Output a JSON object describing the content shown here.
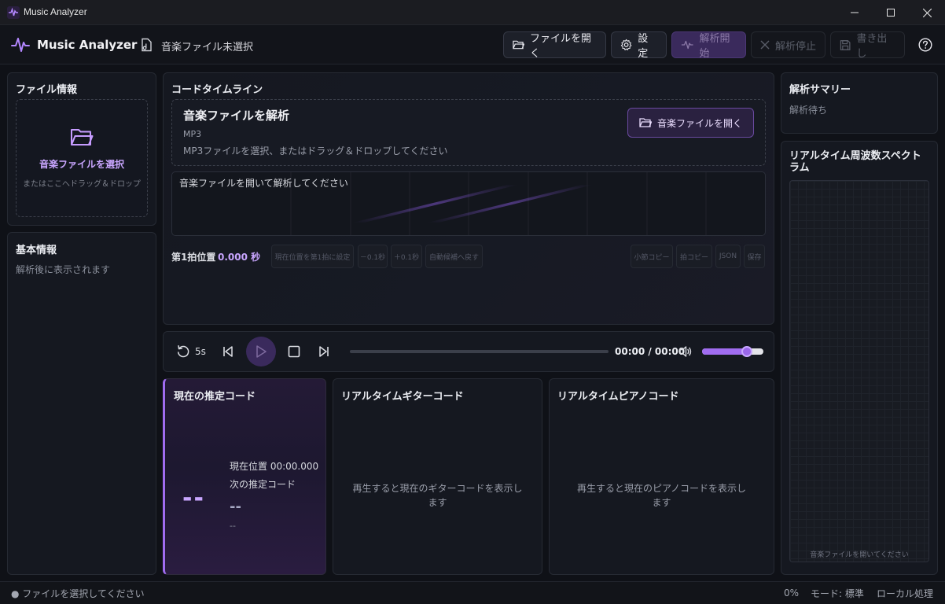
{
  "window": {
    "title": "Music Analyzer",
    "controls": [
      "minimize-icon",
      "maximize-icon",
      "close-icon"
    ]
  },
  "header": {
    "brand": "Music Analyzer",
    "file_status": "音楽ファイル未選択",
    "buttons": {
      "open": "ファイルを開く",
      "settings": "設定",
      "analyze_start": "解析開始",
      "analyze_stop": "解析停止",
      "export": "書き出し"
    }
  },
  "file_info": {
    "title": "ファイル情報",
    "select_label": "音楽ファイルを選択",
    "drop_hint": "またはここへドラッグ＆ドロップ"
  },
  "basic_info": {
    "title": "基本情報",
    "placeholder": "解析後に表示されます"
  },
  "timeline": {
    "title": "コードタイムライン",
    "drop_title": "音楽ファイルを解析",
    "format": "MP3",
    "drop_desc": "MP3ファイルを選択、またはドラッグ＆ドロップしてください",
    "open_button": "音楽ファイルを開く",
    "canvas_message": "音楽ファイルを開いて解析してください",
    "first_beat_label": "第1拍位置",
    "first_beat_value": "0.000 秒",
    "buttons": {
      "set_current": "現在位置を第1拍に設定",
      "minus": "－0.1秒",
      "plus": "＋0.1秒",
      "auto": "自動候補へ戻す",
      "bar_copy": "小節コピー",
      "beat_copy": "拍コピー",
      "json": "JSON",
      "save": "保存"
    }
  },
  "transport": {
    "rewind": "5s",
    "time": "00:00 / 00:00",
    "progress": 0.0,
    "volume": 0.73
  },
  "current_chord": {
    "title": "現在の推定コード",
    "chord": "--",
    "position_label": "現在位置 00:00.000",
    "next_label": "次の推定コード",
    "next_chord": "--",
    "next_detail": "--"
  },
  "guitar": {
    "title": "リアルタイムギターコード",
    "placeholder": "再生すると現在のギターコードを表示します"
  },
  "piano": {
    "title": "リアルタイムピアノコード",
    "placeholder": "再生すると現在のピアノコードを表示します"
  },
  "summary": {
    "title": "解析サマリー",
    "status": "解析待ち"
  },
  "spectrum": {
    "title": "リアルタイム周波数スペクトラム",
    "placeholder": "音楽ファイルを開いてください"
  },
  "statusbar": {
    "message": "● ファイルを選択してください",
    "percent": "0%",
    "mode": "モード: 標準",
    "processing": "ローカル処理"
  },
  "colors": {
    "accent": "#a06cf0",
    "background": "#0f1117",
    "panel": "#151820"
  }
}
